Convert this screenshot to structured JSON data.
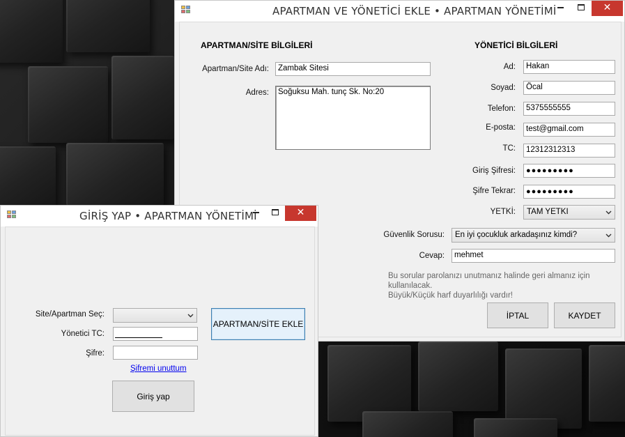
{
  "apartment_window": {
    "title": "APARTMAN VE YÖNETİCİ EKLE • APARTMAN YÖNETİMİ",
    "section_site": "APARTMAN/SİTE BİLGİLERİ",
    "section_manager": "YÖNETİCİ BİLGİLERİ",
    "site_name_label": "Apartman/Site Adı:",
    "site_name_value": "Zambak Sitesi",
    "address_label": "Adres:",
    "address_value": "Soğuksu Mah. tunç Sk. No:20",
    "first_name_label": "Ad:",
    "first_name_value": "Hakan",
    "last_name_label": "Soyad:",
    "last_name_value": "Öcal",
    "phone_label": "Telefon:",
    "phone_value": "5375555555",
    "email_label": "E-posta:",
    "email_value": "test@gmail.com",
    "tc_label": "TC:",
    "tc_value": "12312312313",
    "password_label": "Giriş Şifresi:",
    "password_value": "●●●●●●●●●",
    "password_repeat_label": "Şifre Tekrar:",
    "password_repeat_value": "●●●●●●●●●",
    "authority_label": "YETKİ:",
    "authority_value": "TAM YETKI",
    "security_question_label": "Güvenlik Sorusu:",
    "security_question_value": "En iyi çocukluk arkadaşınız kimdi?",
    "answer_label": "Cevap:",
    "answer_value": "mehmet",
    "note_line1": "Bu sorular parolanızı unutmanız halinde geri almanız için kullanılacak.",
    "note_line2": "Büyük/Küçük harf duyarlılığı vardır!",
    "cancel_button": "İPTAL",
    "save_button": "KAYDET"
  },
  "login_window": {
    "title": "GİRİŞ YAP • APARTMAN YÖNETİMİ",
    "site_select_label": "Site/Apartman Seç:",
    "site_select_value": "",
    "manager_tc_label": "Yönetici TC:",
    "manager_tc_value": "",
    "password_label": "Şifre:",
    "password_value": "",
    "forgot_link": "Şifremi unuttum",
    "add_site_button": "APARTMAN/SİTE EKLE",
    "login_button": "Giriş yap"
  },
  "icons": {
    "app": "app-icon",
    "minimize": "minimize-icon",
    "maximize": "maximize-icon",
    "close": "close-icon",
    "dropdown": "chevron-down-icon"
  },
  "colors": {
    "close_button": "#c7372e",
    "link": "#0000ee",
    "focus_border": "#3c7fb1"
  }
}
